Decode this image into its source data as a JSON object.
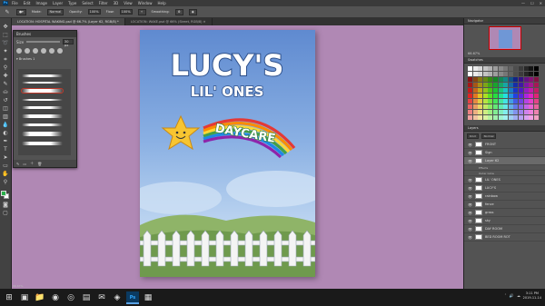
{
  "app": {
    "logo": "Ps",
    "menu": [
      "File",
      "Edit",
      "Image",
      "Layer",
      "Type",
      "Select",
      "Filter",
      "3D",
      "View",
      "Window",
      "Help"
    ],
    "window_controls": [
      "—",
      "☐",
      "✕"
    ]
  },
  "options_bar": {
    "mode_label": "Mode:",
    "mode_value": "Normal",
    "opacity_label": "Opacity:",
    "opacity_value": "100%",
    "flow_label": "Flow:",
    "flow_value": "100%",
    "smoothing_label": "Smoothing:"
  },
  "doc_tabs": [
    {
      "label": "LOCATION: HOSPITAL WAKING.psd @ 66.7% (Layer 62, RGB/8) *"
    },
    {
      "label": "LOCATION: WAKE.psd @ 66% (Street, RGB/8) ✕"
    }
  ],
  "brushes_panel": {
    "title": "Brushes",
    "size_label": "Size",
    "size_value": "30 px",
    "folder_label": "Brushes 1"
  },
  "poster": {
    "title_line1": "LUCY'S",
    "title_line2": "LIL' ONES",
    "rainbow_text": "DAYCARE"
  },
  "navigator": {
    "title": "Navigator",
    "zoom": "66.67%"
  },
  "swatches": {
    "title": "Swatches"
  },
  "layers": {
    "title": "Layers",
    "kind_label": "Kind",
    "blend_value": "Normal",
    "rows": [
      {
        "name": "FRONT",
        "selected": false
      },
      {
        "name": "Sign",
        "selected": false
      },
      {
        "name": "Layer 62",
        "selected": true
      },
      {
        "name": "Effects",
        "fx": true
      },
      {
        "name": "Outer Glow",
        "fx": true
      },
      {
        "name": "LIL' ONES",
        "selected": false
      },
      {
        "name": "LUCY'S",
        "selected": false
      },
      {
        "name": "rainbow",
        "selected": false
      },
      {
        "name": "fence",
        "selected": false
      },
      {
        "name": "grass",
        "selected": false
      },
      {
        "name": "sky",
        "selected": false
      },
      {
        "name": "DAY ROOM",
        "selected": false
      },
      {
        "name": "BED ROOM ROT",
        "selected": false
      }
    ]
  },
  "status": {
    "zoom": "66.67%"
  },
  "taskbar": {
    "time": "3:11 PM",
    "date": "2019-11-14"
  },
  "colors": {
    "foreground": "#2ab04a",
    "background": "#ffffff",
    "canvas_bg": "#b088b4"
  }
}
